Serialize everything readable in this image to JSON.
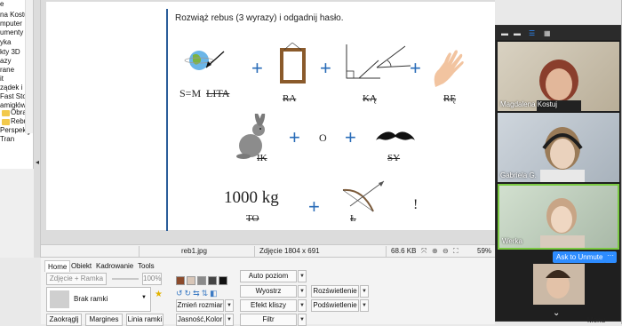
{
  "tree": {
    "items": [
      "e",
      "na Kostu",
      "mputer",
      "umenty",
      "yka",
      "kty 3D",
      "azy",
      "rane",
      "it",
      "ządek i",
      "Fast Ston",
      "amigłów",
      "Obraz",
      "Rebus",
      "Perspekty",
      "Tran"
    ]
  },
  "slide": {
    "instruction": "Rozwiąż rebus (3 wyrazy) i odgadnij hasło.",
    "row1": {
      "sm": "S=M",
      "lita": "LITA",
      "ra": "RA",
      "ka": "KĄ",
      "re": "RĘ",
      "plus": "+"
    },
    "row2": {
      "ik": "IK",
      "o": "O",
      "sy": "SY",
      "plus": "+"
    },
    "row3": {
      "kg": "1000 kg",
      "to": "TO",
      "l": "Ł",
      "excl": "!",
      "plus": "+"
    }
  },
  "status": {
    "filename": "reb1.jpg",
    "dims": "Zdjęcie 1804 x 691",
    "size": "68.6 KB",
    "zoom": "59%"
  },
  "ribbon": {
    "tabs": [
      "Home",
      "Obiekt",
      "Kadrowanie",
      "Tools"
    ],
    "photo_frame": "Zdjęcie + Ramka",
    "zoom_pct": "100%",
    "frame_label": "Brak ramki",
    "round": "Zaokrąglj",
    "margins": "Margines",
    "frame_line": "Linia ramki",
    "auto_level": "Auto poziom",
    "sharpen": "Wyostrz",
    "exposure": "Rozświetlenie",
    "resize": "Zmień rozmiar",
    "brush_fx": "Efekt kliszy",
    "highlight": "Podświetlenie",
    "bright": "Jasność,Kolor",
    "filter": "Filtr"
  },
  "zoom": {
    "participants": [
      "Magdalena Kostuj",
      "Gabriela G.",
      "Werka",
      ""
    ],
    "unmute": "Ask to Unmute",
    "more": "···"
  },
  "menu": "Menu",
  "colors": {
    "accent": "#2a6cb8",
    "zoom_blue": "#2d8cff",
    "active_border": "#7ac943"
  }
}
